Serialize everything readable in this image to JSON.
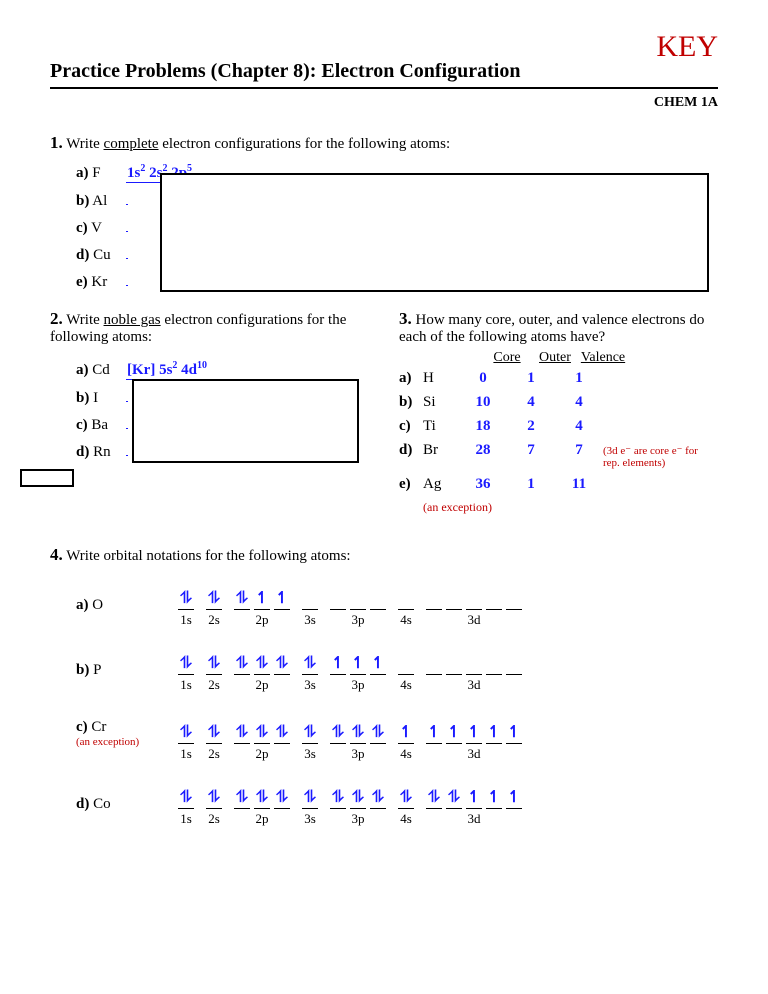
{
  "header": {
    "key_label": "KEY",
    "title": "Practice Problems (Chapter 8): Electron Configuration",
    "course": "CHEM 1A"
  },
  "q1": {
    "num": "1.",
    "text_before": "Write ",
    "text_u": "complete",
    "text_after": " electron configurations for the following atoms:",
    "items": [
      {
        "l": "a)",
        "el": "F",
        "ans_html": "1s<sup>2</sup> 2s<sup>2</sup> 2p<sup>5</sup>"
      },
      {
        "l": "b)",
        "el": "Al",
        "ans_html": ""
      },
      {
        "l": "c)",
        "el": "V",
        "ans_html": ""
      },
      {
        "l": "d)",
        "el": "Cu",
        "ans_html": ""
      },
      {
        "l": "e)",
        "el": "Kr",
        "ans_html": ""
      }
    ]
  },
  "q2": {
    "num": "2.",
    "text_before": "Write ",
    "text_u": "noble gas",
    "text_after": " electron configurations for the following atoms:",
    "items": [
      {
        "l": "a)",
        "el": "Cd",
        "ans_html": "[Kr] 5s<sup>2</sup> 4d<sup>10</sup>"
      },
      {
        "l": "b)",
        "el": "I",
        "ans_html": ""
      },
      {
        "l": "c)",
        "el": "Ba",
        "ans_html": ""
      },
      {
        "l": "d)",
        "el": "Rn",
        "ans_html": ""
      }
    ]
  },
  "q3": {
    "num": "3.",
    "text": "How many core, outer, and valence electrons do each of the following atoms have?",
    "headers": [
      "Core",
      "Outer",
      "Valence"
    ],
    "rows": [
      {
        "l": "a)",
        "el": "H",
        "v": [
          "0",
          "1",
          "1"
        ],
        "note": ""
      },
      {
        "l": "b)",
        "el": "Si",
        "v": [
          "10",
          "4",
          "4"
        ],
        "note": ""
      },
      {
        "l": "c)",
        "el": "Ti",
        "v": [
          "18",
          "2",
          "4"
        ],
        "note": ""
      },
      {
        "l": "d)",
        "el": "Br",
        "v": [
          "28",
          "7",
          "7"
        ],
        "note": "(3d e⁻ are core e⁻ for rep. elements)"
      },
      {
        "l": "e)",
        "el": "Ag",
        "v": [
          "36",
          "1",
          "11"
        ],
        "note": ""
      }
    ],
    "exception_note": "(an exception)"
  },
  "q4": {
    "num": "4.",
    "text": "Write orbital notations for the following atoms:",
    "orbitals": [
      "1s",
      "2s",
      "2p",
      "3s",
      "3p",
      "4s",
      "3d"
    ],
    "orbital_sizes": [
      1,
      1,
      3,
      1,
      3,
      1,
      5
    ],
    "rows": [
      {
        "l": "a)",
        "el": "O",
        "note": "",
        "slots": [
          [
            "⥮"
          ],
          [
            "⥮"
          ],
          [
            "⥮",
            "↿",
            "↿"
          ],
          [
            ""
          ],
          [
            "",
            "",
            ""
          ],
          [
            ""
          ],
          [
            "",
            "",
            "",
            "",
            ""
          ]
        ]
      },
      {
        "l": "b)",
        "el": "P",
        "note": "",
        "slots": [
          [
            "⥮"
          ],
          [
            "⥮"
          ],
          [
            "⥮",
            "⥮",
            "⥮"
          ],
          [
            "⥮"
          ],
          [
            "↿",
            "↿",
            "↿"
          ],
          [
            ""
          ],
          [
            "",
            "",
            "",
            "",
            ""
          ]
        ]
      },
      {
        "l": "c)",
        "el": "Cr",
        "note": "(an exception)",
        "slots": [
          [
            "⥮"
          ],
          [
            "⥮"
          ],
          [
            "⥮",
            "⥮",
            "⥮"
          ],
          [
            "⥮"
          ],
          [
            "⥮",
            "⥮",
            "⥮"
          ],
          [
            "↿"
          ],
          [
            "↿",
            "↿",
            "↿",
            "↿",
            "↿"
          ]
        ]
      },
      {
        "l": "d)",
        "el": "Co",
        "note": "",
        "slots": [
          [
            "⥮"
          ],
          [
            "⥮"
          ],
          [
            "⥮",
            "⥮",
            "⥮"
          ],
          [
            "⥮"
          ],
          [
            "⥮",
            "⥮",
            "⥮"
          ],
          [
            "⥮"
          ],
          [
            "⥮",
            "⥮",
            "↿",
            "↿",
            "↿"
          ]
        ]
      }
    ]
  }
}
